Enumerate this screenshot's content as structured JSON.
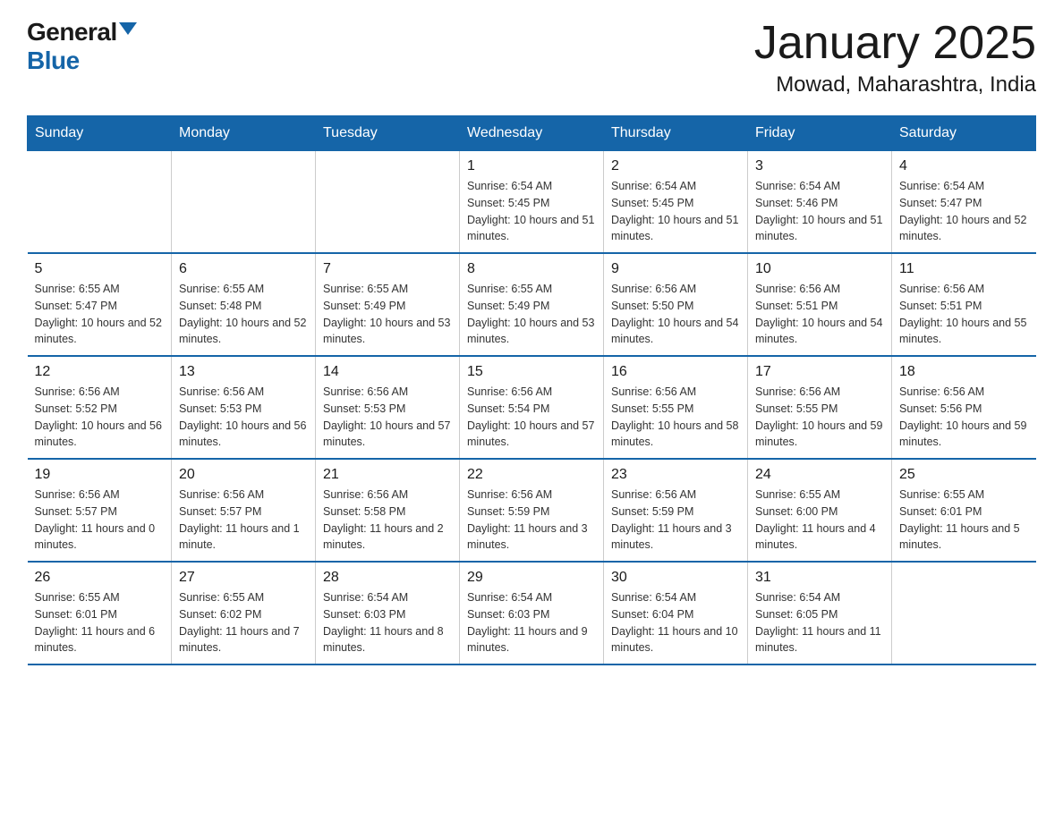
{
  "logo": {
    "general": "General",
    "blue": "Blue"
  },
  "title": "January 2025",
  "subtitle": "Mowad, Maharashtra, India",
  "days_of_week": [
    "Sunday",
    "Monday",
    "Tuesday",
    "Wednesday",
    "Thursday",
    "Friday",
    "Saturday"
  ],
  "weeks": [
    [
      {
        "num": "",
        "info": ""
      },
      {
        "num": "",
        "info": ""
      },
      {
        "num": "",
        "info": ""
      },
      {
        "num": "1",
        "info": "Sunrise: 6:54 AM\nSunset: 5:45 PM\nDaylight: 10 hours and 51 minutes."
      },
      {
        "num": "2",
        "info": "Sunrise: 6:54 AM\nSunset: 5:45 PM\nDaylight: 10 hours and 51 minutes."
      },
      {
        "num": "3",
        "info": "Sunrise: 6:54 AM\nSunset: 5:46 PM\nDaylight: 10 hours and 51 minutes."
      },
      {
        "num": "4",
        "info": "Sunrise: 6:54 AM\nSunset: 5:47 PM\nDaylight: 10 hours and 52 minutes."
      }
    ],
    [
      {
        "num": "5",
        "info": "Sunrise: 6:55 AM\nSunset: 5:47 PM\nDaylight: 10 hours and 52 minutes."
      },
      {
        "num": "6",
        "info": "Sunrise: 6:55 AM\nSunset: 5:48 PM\nDaylight: 10 hours and 52 minutes."
      },
      {
        "num": "7",
        "info": "Sunrise: 6:55 AM\nSunset: 5:49 PM\nDaylight: 10 hours and 53 minutes."
      },
      {
        "num": "8",
        "info": "Sunrise: 6:55 AM\nSunset: 5:49 PM\nDaylight: 10 hours and 53 minutes."
      },
      {
        "num": "9",
        "info": "Sunrise: 6:56 AM\nSunset: 5:50 PM\nDaylight: 10 hours and 54 minutes."
      },
      {
        "num": "10",
        "info": "Sunrise: 6:56 AM\nSunset: 5:51 PM\nDaylight: 10 hours and 54 minutes."
      },
      {
        "num": "11",
        "info": "Sunrise: 6:56 AM\nSunset: 5:51 PM\nDaylight: 10 hours and 55 minutes."
      }
    ],
    [
      {
        "num": "12",
        "info": "Sunrise: 6:56 AM\nSunset: 5:52 PM\nDaylight: 10 hours and 56 minutes."
      },
      {
        "num": "13",
        "info": "Sunrise: 6:56 AM\nSunset: 5:53 PM\nDaylight: 10 hours and 56 minutes."
      },
      {
        "num": "14",
        "info": "Sunrise: 6:56 AM\nSunset: 5:53 PM\nDaylight: 10 hours and 57 minutes."
      },
      {
        "num": "15",
        "info": "Sunrise: 6:56 AM\nSunset: 5:54 PM\nDaylight: 10 hours and 57 minutes."
      },
      {
        "num": "16",
        "info": "Sunrise: 6:56 AM\nSunset: 5:55 PM\nDaylight: 10 hours and 58 minutes."
      },
      {
        "num": "17",
        "info": "Sunrise: 6:56 AM\nSunset: 5:55 PM\nDaylight: 10 hours and 59 minutes."
      },
      {
        "num": "18",
        "info": "Sunrise: 6:56 AM\nSunset: 5:56 PM\nDaylight: 10 hours and 59 minutes."
      }
    ],
    [
      {
        "num": "19",
        "info": "Sunrise: 6:56 AM\nSunset: 5:57 PM\nDaylight: 11 hours and 0 minutes."
      },
      {
        "num": "20",
        "info": "Sunrise: 6:56 AM\nSunset: 5:57 PM\nDaylight: 11 hours and 1 minute."
      },
      {
        "num": "21",
        "info": "Sunrise: 6:56 AM\nSunset: 5:58 PM\nDaylight: 11 hours and 2 minutes."
      },
      {
        "num": "22",
        "info": "Sunrise: 6:56 AM\nSunset: 5:59 PM\nDaylight: 11 hours and 3 minutes."
      },
      {
        "num": "23",
        "info": "Sunrise: 6:56 AM\nSunset: 5:59 PM\nDaylight: 11 hours and 3 minutes."
      },
      {
        "num": "24",
        "info": "Sunrise: 6:55 AM\nSunset: 6:00 PM\nDaylight: 11 hours and 4 minutes."
      },
      {
        "num": "25",
        "info": "Sunrise: 6:55 AM\nSunset: 6:01 PM\nDaylight: 11 hours and 5 minutes."
      }
    ],
    [
      {
        "num": "26",
        "info": "Sunrise: 6:55 AM\nSunset: 6:01 PM\nDaylight: 11 hours and 6 minutes."
      },
      {
        "num": "27",
        "info": "Sunrise: 6:55 AM\nSunset: 6:02 PM\nDaylight: 11 hours and 7 minutes."
      },
      {
        "num": "28",
        "info": "Sunrise: 6:54 AM\nSunset: 6:03 PM\nDaylight: 11 hours and 8 minutes."
      },
      {
        "num": "29",
        "info": "Sunrise: 6:54 AM\nSunset: 6:03 PM\nDaylight: 11 hours and 9 minutes."
      },
      {
        "num": "30",
        "info": "Sunrise: 6:54 AM\nSunset: 6:04 PM\nDaylight: 11 hours and 10 minutes."
      },
      {
        "num": "31",
        "info": "Sunrise: 6:54 AM\nSunset: 6:05 PM\nDaylight: 11 hours and 11 minutes."
      },
      {
        "num": "",
        "info": ""
      }
    ]
  ]
}
